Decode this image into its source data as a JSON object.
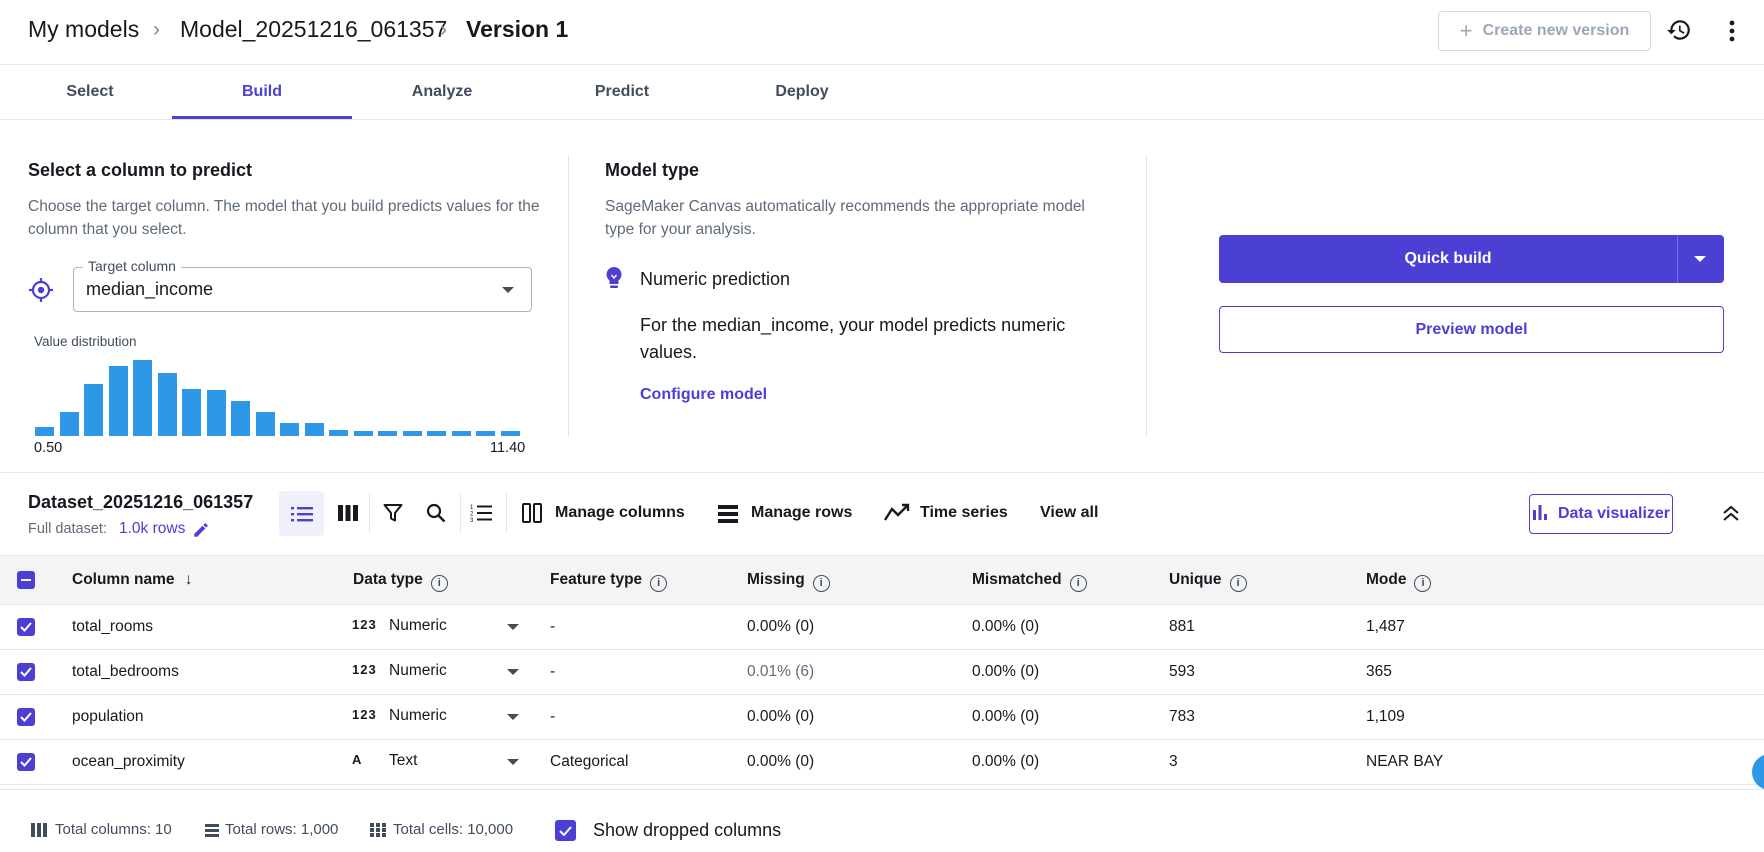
{
  "breadcrumb": {
    "root": "My models",
    "model": "Model_20251216_061357",
    "version": "Version 1"
  },
  "header": {
    "create_version_label": "Create new version",
    "history_icon": "history-icon",
    "more_icon": "more-vertical-icon"
  },
  "tabs": [
    {
      "label": "Select",
      "active": false
    },
    {
      "label": "Build",
      "active": true
    },
    {
      "label": "Analyze",
      "active": false
    },
    {
      "label": "Predict",
      "active": false
    },
    {
      "label": "Deploy",
      "active": false
    }
  ],
  "target": {
    "title": "Select a column to predict",
    "description": "Choose the target column. The model that you build predicts values for the column that you select.",
    "field_label": "Target column",
    "value": "median_income",
    "distribution_label": "Value distribution",
    "dist_min": "0.50",
    "dist_max": "11.40",
    "histogram": [
      7,
      19,
      41,
      55,
      60,
      50,
      37,
      36,
      28,
      19,
      10,
      10,
      5,
      4,
      4,
      4,
      4,
      4,
      4,
      4
    ]
  },
  "model_type": {
    "title": "Model type",
    "description": "SageMaker Canvas automatically recommends the appropriate model type for your analysis.",
    "type_name": "Numeric prediction",
    "type_desc": "For the median_income, your model predicts numeric values.",
    "configure_label": "Configure model"
  },
  "actions": {
    "quick_build_label": "Quick build",
    "preview_label": "Preview model"
  },
  "dataset": {
    "name": "Dataset_20251216_061357",
    "full_label": "Full dataset:",
    "rows_link": "1.0k rows",
    "manage_columns": "Manage columns",
    "manage_rows": "Manage rows",
    "time_series": "Time series",
    "view_all": "View all",
    "visualizer": "Data visualizer"
  },
  "table": {
    "headers": {
      "column_name": "Column name",
      "data_type": "Data type",
      "feature_type": "Feature type",
      "missing": "Missing",
      "mismatched": "Mismatched",
      "unique": "Unique",
      "mode": "Mode"
    },
    "rows": [
      {
        "name": "total_rooms",
        "type_icon": "123",
        "type": "Numeric",
        "feature": "-",
        "missing": "0.00% (0)",
        "mismatched": "0.00% (0)",
        "unique": "881",
        "mode": "1,487"
      },
      {
        "name": "total_bedrooms",
        "type_icon": "123",
        "type": "Numeric",
        "feature": "-",
        "missing": "0.01% (6)",
        "mismatched": "0.00% (0)",
        "unique": "593",
        "mode": "365"
      },
      {
        "name": "population",
        "type_icon": "123",
        "type": "Numeric",
        "feature": "-",
        "missing": "0.00% (0)",
        "mismatched": "0.00% (0)",
        "unique": "783",
        "mode": "1,109"
      },
      {
        "name": "ocean_proximity",
        "type_icon": "A",
        "type": "Text",
        "feature": "Categorical",
        "missing": "0.00% (0)",
        "mismatched": "0.00% (0)",
        "unique": "3",
        "mode": "NEAR BAY"
      }
    ]
  },
  "footer": {
    "total_columns": "Total columns: 10",
    "total_rows": "Total rows: 1,000",
    "total_cells": "Total cells: 10,000",
    "show_dropped": "Show dropped columns"
  },
  "colors": {
    "accent": "#4c3fd4",
    "histogram": "#2e97e6"
  }
}
